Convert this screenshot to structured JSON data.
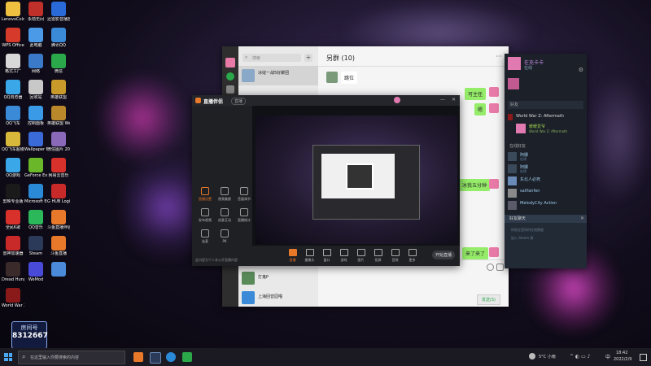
{
  "desktop": {
    "icons": [
      {
        "label": "LenovoCold 小黑",
        "color": "#f0c040"
      },
      {
        "label": "永劫无间",
        "color": "#c0302a"
      },
      {
        "label": "迅雷影音播放",
        "color": "#2a6ad8"
      },
      {
        "label": "WPS Office",
        "color": "#d63a2a"
      },
      {
        "label": "此电脑",
        "color": "#4a9ae8"
      },
      {
        "label": "腾讯QQ",
        "color": "#3a8ad8"
      },
      {
        "label": "格式工厂",
        "color": "#d8d8d8"
      },
      {
        "label": "网络",
        "color": "#3a7ac8"
      },
      {
        "label": "微信",
        "color": "#2aa84a"
      },
      {
        "label": "QQ浏览器",
        "color": "#3aa8e8"
      },
      {
        "label": "回收站",
        "color": "#c8c8c8"
      },
      {
        "label": "英雄联盟",
        "color": "#c89a2a"
      },
      {
        "label": "QQ飞车",
        "color": "#3a8ad8"
      },
      {
        "label": "控制面板",
        "color": "#3a9ae8"
      },
      {
        "label": "英雄联盟 WeGame版",
        "color": "#b8882a"
      },
      {
        "label": "QQ飞车超级工具",
        "color": "#d8b83a"
      },
      {
        "label": "Wallpaper Engine",
        "color": "#3a6ad8"
      },
      {
        "label": "微信图片 2022011...",
        "color": "#8a6ab8"
      },
      {
        "label": "QQ游戏",
        "color": "#3aa8e8"
      },
      {
        "label": "GeForce Experience",
        "color": "#6ab82a"
      },
      {
        "label": "网易云音乐",
        "color": "#d8302a"
      },
      {
        "label": "剪映专业版",
        "color": "#1a1a1a"
      },
      {
        "label": "Microsoft Edge",
        "color": "#2a8ad8"
      },
      {
        "label": "G HUB Logitech",
        "color": "#c82a2a"
      },
      {
        "label": "全民K歌",
        "color": "#d8302a"
      },
      {
        "label": "QQ音乐",
        "color": "#2ab85a"
      },
      {
        "label": "斗鱼直播伴侣",
        "color": "#e8782a"
      },
      {
        "label": "雷神加速器",
        "color": "#c82a2a"
      },
      {
        "label": "Steam",
        "color": "#2a3a58"
      },
      {
        "label": "斗鱼直播",
        "color": "#e8782a"
      },
      {
        "label": "Dread Hunger",
        "color": "#3a2a2a"
      },
      {
        "label": "WeMod",
        "color": "#4a4ad8"
      },
      {
        "label": "",
        "color": "#4a8ad8"
      },
      {
        "label": "World War Z Aftermath",
        "color": "#8a1a1a"
      }
    ],
    "douyu_badge": {
      "title": "房间号",
      "number": "8312667"
    }
  },
  "wechat": {
    "search_placeholder": "搜索",
    "add_btn": "+",
    "chat_title": "另群 (10)",
    "list_items": [
      {
        "name": "冰绽一战5好聚团",
        "preview": "",
        "time": ""
      },
      {
        "name": "打鬼P",
        "preview": "",
        "time": ""
      },
      {
        "name": "上海回音园喵",
        "preview": "",
        "time": ""
      }
    ],
    "messages": [
      {
        "text": "跳位",
        "side": "left"
      },
      {
        "text": "可主任",
        "side": "right"
      },
      {
        "text": "嗯",
        "side": "right"
      },
      {
        "text": "冰我五分钟",
        "side": "right"
      },
      {
        "text": "来了来了",
        "side": "right"
      }
    ],
    "send_label": "发送(S)"
  },
  "steam": {
    "username": "在充卡卡",
    "status": "在线",
    "friends_header": "好友",
    "game_playing": "World War Z: Aftermath",
    "game_friend": "暖暖爱爷",
    "online_header": "在线好友",
    "friends": [
      {
        "name": "阿娜",
        "status": "在线"
      },
      {
        "name": "阿娜",
        "status": "在线"
      },
      {
        "name": "东北人必死",
        "status": ""
      },
      {
        "name": "sallfanfen",
        "status": ""
      },
      {
        "name": "MelodyCity Action",
        "status": ""
      }
    ],
    "chat_tab": "好友聊天",
    "chat_hint1": "你现在是同时在线数据",
    "chat_hint2": "加入 Steam 群"
  },
  "obs": {
    "app_title": "直播伴侣",
    "tab": "直播",
    "side_buttons": [
      "直播设置",
      "视频美颜",
      "音量调节",
      "发布视频",
      "创意互动",
      "直播统计",
      "连麦",
      "PK"
    ],
    "bottom_buttons": [
      "直播",
      "摄像头",
      "窗口",
      "游戏",
      "图片",
      "投屏",
      "音频",
      "更多"
    ],
    "start_label": "开始直播",
    "footer_text": "此内容为个人非公开直播内容"
  },
  "taskbar": {
    "search_placeholder": "在这里输入你要搜索的内容",
    "weather": "5°C 小雨",
    "time": "18:42",
    "date": "2022/2/9",
    "ime": "中"
  }
}
